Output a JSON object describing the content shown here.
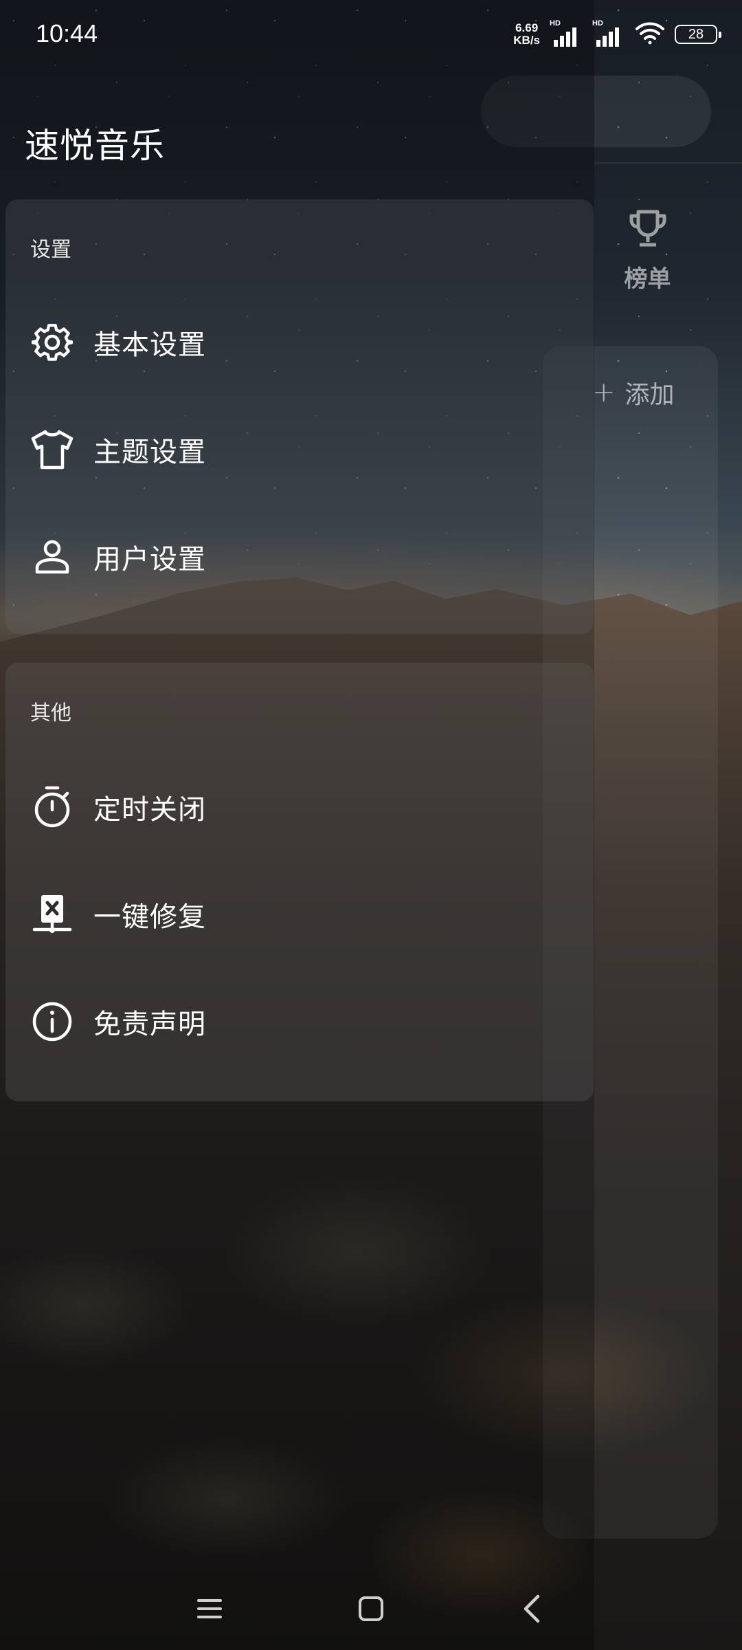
{
  "status_bar": {
    "time": "10:44",
    "net_speed_value": "6.69",
    "net_speed_unit": "KB/s",
    "signal_1_label": "HD",
    "signal_2_label": "HD",
    "battery_level": "28"
  },
  "main_page": {
    "rank_label": "榜单",
    "add_label": "添加",
    "add_symbol": "+"
  },
  "drawer": {
    "app_title": "速悦音乐",
    "sections": [
      {
        "title": "设置",
        "items": [
          {
            "label": "基本设置",
            "icon": "gear-icon"
          },
          {
            "label": "主题设置",
            "icon": "tshirt-icon"
          },
          {
            "label": "用户设置",
            "icon": "user-icon"
          }
        ]
      },
      {
        "title": "其他",
        "items": [
          {
            "label": "定时关闭",
            "icon": "timer-icon"
          },
          {
            "label": "一键修复",
            "icon": "repair-icon"
          },
          {
            "label": "免责声明",
            "icon": "info-icon"
          }
        ]
      }
    ]
  },
  "nav_bar": {
    "buttons": [
      "menu-icon",
      "home-icon",
      "back-icon"
    ]
  },
  "colors": {
    "text_primary": "#ffffff",
    "card_bg": "rgba(110,115,120,0.22)"
  }
}
